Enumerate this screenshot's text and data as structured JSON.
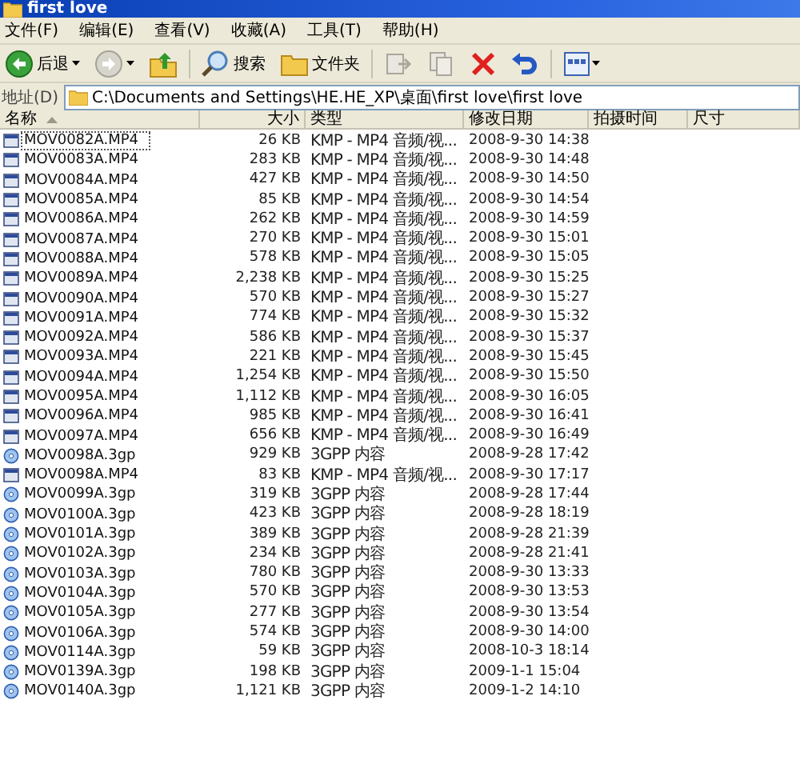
{
  "window": {
    "title": "first love"
  },
  "menu": [
    "文件(F)",
    "编辑(E)",
    "查看(V)",
    "收藏(A)",
    "工具(T)",
    "帮助(H)"
  ],
  "toolbar": [
    {
      "kind": "back",
      "label": "后退"
    },
    {
      "kind": "forward"
    },
    {
      "kind": "up"
    },
    {
      "kind": "search",
      "label": "搜索"
    },
    {
      "kind": "folders",
      "label": "文件夹"
    },
    {
      "kind": "move"
    },
    {
      "kind": "copy"
    },
    {
      "kind": "delete"
    },
    {
      "kind": "undo"
    },
    {
      "kind": "views"
    }
  ],
  "address": {
    "label": "地址(D)",
    "value": "C:\\Documents and Settings\\HE.HE_XP\\桌面\\first love\\first love"
  },
  "columns": [
    {
      "label": "名称",
      "sorted": true
    },
    {
      "label": "大小",
      "sorted": false
    },
    {
      "label": "类型",
      "sorted": false
    },
    {
      "label": "修改日期",
      "sorted": false
    },
    {
      "label": "拍摄时间",
      "sorted": false
    },
    {
      "label": "尺寸",
      "sorted": false
    }
  ],
  "rows": [
    {
      "kind": "video",
      "name": "MOV0082A.MP4",
      "size": "26 KB",
      "type": "KMP - MP4 音频/视...",
      "modified": "2008-9-30 14:38",
      "focused": true
    },
    {
      "kind": "video",
      "name": "MOV0083A.MP4",
      "size": "283 KB",
      "type": "KMP - MP4 音频/视...",
      "modified": "2008-9-30 14:48",
      "focused": false
    },
    {
      "kind": "video",
      "name": "MOV0084A.MP4",
      "size": "427 KB",
      "type": "KMP - MP4 音频/视...",
      "modified": "2008-9-30 14:50",
      "focused": false
    },
    {
      "kind": "video",
      "name": "MOV0085A.MP4",
      "size": "85 KB",
      "type": "KMP - MP4 音频/视...",
      "modified": "2008-9-30 14:54",
      "focused": false
    },
    {
      "kind": "video",
      "name": "MOV0086A.MP4",
      "size": "262 KB",
      "type": "KMP - MP4 音频/视...",
      "modified": "2008-9-30 14:59",
      "focused": false
    },
    {
      "kind": "video",
      "name": "MOV0087A.MP4",
      "size": "270 KB",
      "type": "KMP - MP4 音频/视...",
      "modified": "2008-9-30 15:01",
      "focused": false
    },
    {
      "kind": "video",
      "name": "MOV0088A.MP4",
      "size": "578 KB",
      "type": "KMP - MP4 音频/视...",
      "modified": "2008-9-30 15:05",
      "focused": false
    },
    {
      "kind": "video",
      "name": "MOV0089A.MP4",
      "size": "2,238 KB",
      "type": "KMP - MP4 音频/视...",
      "modified": "2008-9-30 15:25",
      "focused": false
    },
    {
      "kind": "video",
      "name": "MOV0090A.MP4",
      "size": "570 KB",
      "type": "KMP - MP4 音频/视...",
      "modified": "2008-9-30 15:27",
      "focused": false
    },
    {
      "kind": "video",
      "name": "MOV0091A.MP4",
      "size": "774 KB",
      "type": "KMP - MP4 音频/视...",
      "modified": "2008-9-30 15:32",
      "focused": false
    },
    {
      "kind": "video",
      "name": "MOV0092A.MP4",
      "size": "586 KB",
      "type": "KMP - MP4 音频/视...",
      "modified": "2008-9-30 15:37",
      "focused": false
    },
    {
      "kind": "video",
      "name": "MOV0093A.MP4",
      "size": "221 KB",
      "type": "KMP - MP4 音频/视...",
      "modified": "2008-9-30 15:45",
      "focused": false
    },
    {
      "kind": "video",
      "name": "MOV0094A.MP4",
      "size": "1,254 KB",
      "type": "KMP - MP4 音频/视...",
      "modified": "2008-9-30 15:50",
      "focused": false
    },
    {
      "kind": "video",
      "name": "MOV0095A.MP4",
      "size": "1,112 KB",
      "type": "KMP - MP4 音频/视...",
      "modified": "2008-9-30 16:05",
      "focused": false
    },
    {
      "kind": "video",
      "name": "MOV0096A.MP4",
      "size": "985 KB",
      "type": "KMP - MP4 音频/视...",
      "modified": "2008-9-30 16:41",
      "focused": false
    },
    {
      "kind": "video",
      "name": "MOV0097A.MP4",
      "size": "656 KB",
      "type": "KMP - MP4 音频/视...",
      "modified": "2008-9-30 16:49",
      "focused": false
    },
    {
      "kind": "disc",
      "name": "MOV0098A.3gp",
      "size": "929 KB",
      "type": "3GPP 内容",
      "modified": "2008-9-28 17:42",
      "focused": false
    },
    {
      "kind": "video",
      "name": "MOV0098A.MP4",
      "size": "83 KB",
      "type": "KMP - MP4 音频/视...",
      "modified": "2008-9-30 17:17",
      "focused": false
    },
    {
      "kind": "disc",
      "name": "MOV0099A.3gp",
      "size": "319 KB",
      "type": "3GPP 内容",
      "modified": "2008-9-28 17:44",
      "focused": false
    },
    {
      "kind": "disc",
      "name": "MOV0100A.3gp",
      "size": "423 KB",
      "type": "3GPP 内容",
      "modified": "2008-9-28 18:19",
      "focused": false
    },
    {
      "kind": "disc",
      "name": "MOV0101A.3gp",
      "size": "389 KB",
      "type": "3GPP 内容",
      "modified": "2008-9-28 21:39",
      "focused": false
    },
    {
      "kind": "disc",
      "name": "MOV0102A.3gp",
      "size": "234 KB",
      "type": "3GPP 内容",
      "modified": "2008-9-28 21:41",
      "focused": false
    },
    {
      "kind": "disc",
      "name": "MOV0103A.3gp",
      "size": "780 KB",
      "type": "3GPP 内容",
      "modified": "2008-9-30 13:33",
      "focused": false
    },
    {
      "kind": "disc",
      "name": "MOV0104A.3gp",
      "size": "570 KB",
      "type": "3GPP 内容",
      "modified": "2008-9-30 13:53",
      "focused": false
    },
    {
      "kind": "disc",
      "name": "MOV0105A.3gp",
      "size": "277 KB",
      "type": "3GPP 内容",
      "modified": "2008-9-30 13:54",
      "focused": false
    },
    {
      "kind": "disc",
      "name": "MOV0106A.3gp",
      "size": "574 KB",
      "type": "3GPP 内容",
      "modified": "2008-9-30 14:00",
      "focused": false
    },
    {
      "kind": "disc",
      "name": "MOV0114A.3gp",
      "size": "59 KB",
      "type": "3GPP 内容",
      "modified": "2008-10-3 18:14",
      "focused": false
    },
    {
      "kind": "disc",
      "name": "MOV0139A.3gp",
      "size": "198 KB",
      "type": "3GPP 内容",
      "modified": "2009-1-1 15:04",
      "focused": false
    },
    {
      "kind": "disc",
      "name": "MOV0140A.3gp",
      "size": "1,121 KB",
      "type": "3GPP 内容",
      "modified": "2009-1-2 14:10",
      "focused": false
    }
  ]
}
